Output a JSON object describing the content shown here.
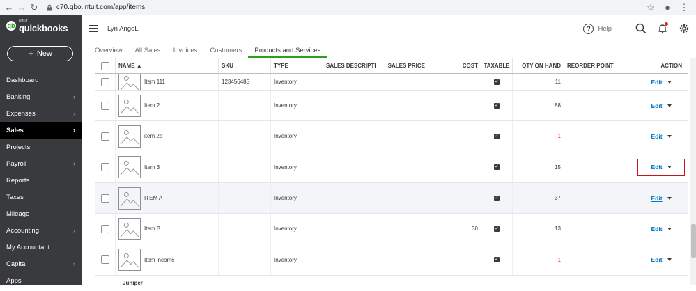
{
  "browser": {
    "url": "c70.qbo.intuit.com/app/items"
  },
  "brand": {
    "small": "intuit",
    "name": "quickbooks",
    "accent": "#2ca01c",
    "sidebar_bg": "#393a3d"
  },
  "sidebar": {
    "new_label": "New",
    "items": [
      {
        "label": "Dashboard",
        "chevron": false
      },
      {
        "label": "Banking",
        "chevron": true
      },
      {
        "label": "Expenses",
        "chevron": true
      },
      {
        "label": "Sales",
        "chevron": true,
        "active": true
      },
      {
        "label": "Projects",
        "chevron": false
      },
      {
        "label": "Payroll",
        "chevron": true
      },
      {
        "label": "Reports",
        "chevron": false
      },
      {
        "label": "Taxes",
        "chevron": false
      },
      {
        "label": "Mileage",
        "chevron": false
      },
      {
        "label": "Accounting",
        "chevron": true
      },
      {
        "label": "My Accountant",
        "chevron": false
      },
      {
        "label": "Capital",
        "chevron": true
      },
      {
        "label": "Apps",
        "chevron": false
      }
    ]
  },
  "header": {
    "company": "Lyn AngeL",
    "help": "Help"
  },
  "tabs": [
    {
      "label": "Overview"
    },
    {
      "label": "All Sales"
    },
    {
      "label": "Invoices"
    },
    {
      "label": "Customers"
    },
    {
      "label": "Products and Services",
      "active": true
    }
  ],
  "table": {
    "columns": {
      "name": "NAME ▲",
      "sku": "SKU",
      "type": "TYPE",
      "desc": "SALES DESCRIPTION",
      "price": "SALES PRICE",
      "cost": "COST",
      "taxable": "TAXABLE",
      "qty": "QTY ON HAND",
      "reorder": "REORDER POINT",
      "action": "ACTION"
    },
    "rows": [
      {
        "name": "Item 111",
        "sku": "123456485",
        "type": "Inventory",
        "cost": "",
        "qty": "11",
        "neg": false,
        "edit": "Edit"
      },
      {
        "name": "Item 2",
        "sku": "",
        "type": "Inventory",
        "cost": "",
        "qty": "88",
        "neg": false,
        "edit": "Edit"
      },
      {
        "name": "item 2a",
        "sku": "",
        "type": "Inventory",
        "cost": "",
        "qty": "-1",
        "neg": true,
        "edit": "Edit"
      },
      {
        "name": "Item 3",
        "sku": "",
        "type": "Inventory",
        "cost": "",
        "qty": "15",
        "neg": false,
        "edit": "Edit",
        "boxed": true
      },
      {
        "name": "ITEM A",
        "sku": "",
        "type": "Inventory",
        "cost": "",
        "qty": "37",
        "neg": false,
        "edit": "Edit",
        "hover": true
      },
      {
        "name": "Item B",
        "sku": "",
        "type": "Inventory",
        "cost": "30",
        "qty": "13",
        "neg": false,
        "edit": "Edit"
      },
      {
        "name": "Item income",
        "sku": "",
        "type": "Inventory",
        "cost": "",
        "qty": "-1",
        "neg": true,
        "edit": "Edit"
      }
    ],
    "group_label": "Juniper"
  }
}
